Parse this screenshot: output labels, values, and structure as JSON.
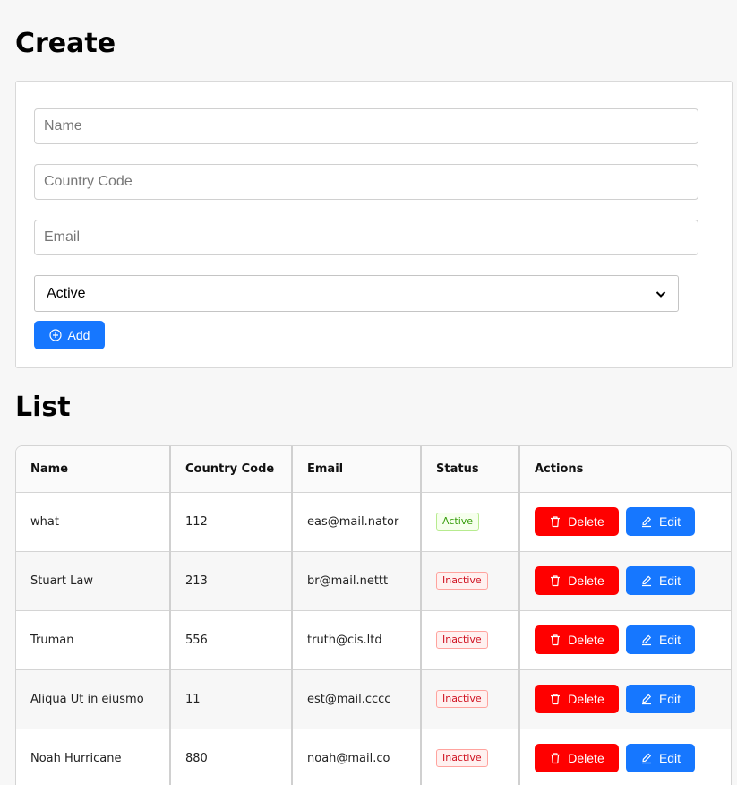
{
  "create": {
    "title": "Create",
    "name_placeholder": "Name",
    "country_code_placeholder": "Country Code",
    "email_placeholder": "Email",
    "status_selected": "Active",
    "add_label": "Add"
  },
  "list": {
    "title": "List",
    "columns": [
      "Name",
      "Country Code",
      "Email",
      "Status",
      "Actions"
    ],
    "delete_label": "Delete",
    "edit_label": "Edit",
    "rows": [
      {
        "name": "what",
        "country_code": "112",
        "email": "eas@mail.nator",
        "status": "Active"
      },
      {
        "name": "Stuart Law",
        "country_code": "213",
        "email": "br@mail.nettt",
        "status": "Inactive"
      },
      {
        "name": "Truman",
        "country_code": "556",
        "email": "truth@cis.ltd",
        "status": "Inactive"
      },
      {
        "name": "Aliqua Ut in eiusmo",
        "country_code": "11",
        "email": "est@mail.cccc",
        "status": "Inactive"
      },
      {
        "name": "Noah Hurricane",
        "country_code": "880",
        "email": "noah@mail.co",
        "status": "Inactive"
      }
    ]
  },
  "icons": {
    "add": "plus-circle-icon",
    "delete": "trash-icon",
    "edit": "pencil-icon",
    "select": "chevron-down-icon"
  },
  "colors": {
    "primary": "#1677ff",
    "danger": "#ff0000",
    "active_tag": "#389e0d",
    "inactive_tag": "#cf1322"
  }
}
